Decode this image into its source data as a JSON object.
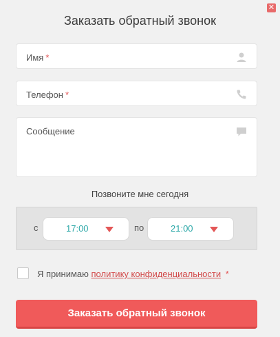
{
  "close": {
    "glyph": "✕"
  },
  "title": "Заказать обратный звонок",
  "fields": {
    "name": {
      "label": "Имя",
      "required_mark": "*",
      "icon": "user-icon"
    },
    "phone": {
      "label": "Телефон",
      "required_mark": "*",
      "icon": "phone-icon"
    },
    "message": {
      "label": "Сообщение",
      "icon": "chat-icon"
    }
  },
  "call_time": {
    "label": "Позвоните мне сегодня",
    "from_label": "с",
    "from_value": "17:00",
    "to_label": "по",
    "to_value": "21:00"
  },
  "consent": {
    "text_before": "Я принимаю",
    "link_text": "политику конфиденциальности",
    "required_mark": "*"
  },
  "submit_label": "Заказать обратный звонок",
  "colors": {
    "accent": "#f05a5a",
    "time_text": "#2aa7a7"
  }
}
